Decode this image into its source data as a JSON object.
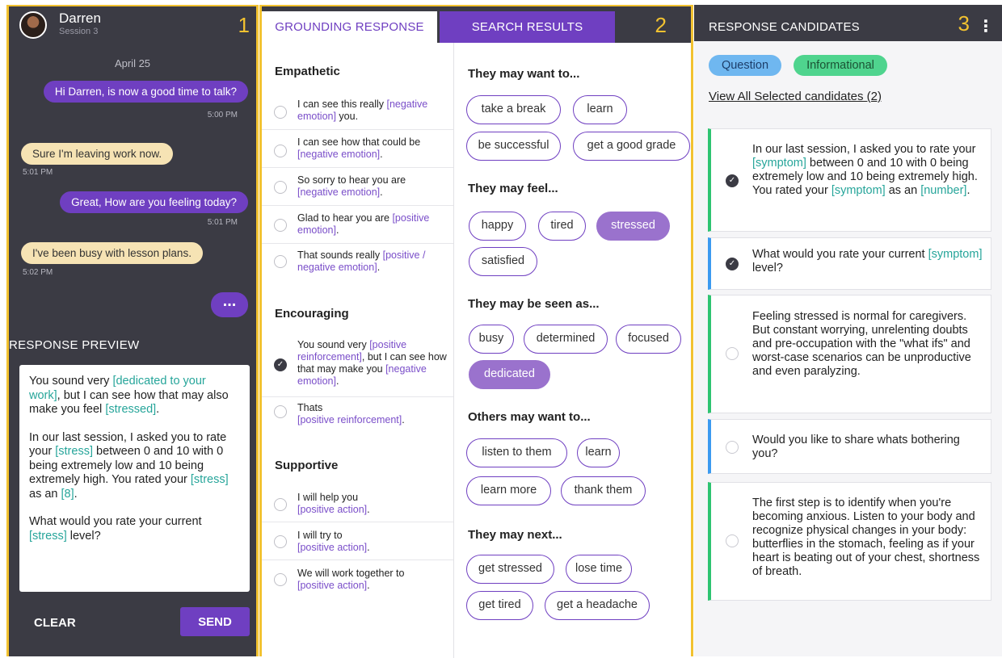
{
  "panel1": {
    "number": "1",
    "user_name": "Darren",
    "session": "Session 3",
    "date": "April 25",
    "messages": [
      {
        "text": "Hi Darren, is now a good time to talk?",
        "time": "5:00 PM"
      },
      {
        "text": "Sure I'm leaving work now.",
        "time": "5:01 PM"
      },
      {
        "text": "Great, How are you feeling today?",
        "time": "5:01 PM"
      },
      {
        "text": "I've been busy with lesson plans.",
        "time": "5:02 PM"
      }
    ],
    "more_label": "...",
    "preview_title": "RESPONSE PREVIEW",
    "preview": {
      "p1_a": "You sound very ",
      "p1_ph1": "[dedicated to your work]",
      "p1_b": ", but I can see how that may also make you feel ",
      "p1_ph2": "[stressed]",
      "p1_c": ".",
      "p2_a": "In our last session, I asked you to rate your ",
      "p2_ph1": "[stress]",
      "p2_b": " between 0 and 10 with 0 being extremely low and 10 being extremely high. You rated your ",
      "p2_ph2": "[stress]",
      "p2_c": " as an ",
      "p2_ph3": "[8]",
      "p2_d": ".",
      "p3_a": "What would you rate your current ",
      "p3_ph1": "[stress]",
      "p3_b": " level?"
    },
    "clear_label": "CLEAR",
    "send_label": "SEND"
  },
  "panel2": {
    "number": "2",
    "tabs": [
      "GROUNDING RESPONSE",
      "SEARCH RESULTS"
    ],
    "categories": {
      "empathetic": {
        "title": "Empathetic",
        "options": [
          {
            "a": "I can see this really ",
            "ph": "[negative emotion]",
            "b": " you."
          },
          {
            "a": "I can see how that could be ",
            "ph": "[negative emotion]",
            "b": "."
          },
          {
            "a": "So sorry to hear you are ",
            "ph": "[negative emotion]",
            "b": "."
          },
          {
            "a": "Glad to hear you are ",
            "ph": "[positive emotion]",
            "b": "."
          },
          {
            "a": "That sounds really ",
            "ph": "[positive / negative emotion]",
            "b": "."
          }
        ]
      },
      "encouraging": {
        "title": "Encouraging",
        "options": [
          {
            "a": "You sound very ",
            "ph": "[positive reinforcement]",
            "b": ", but I can see how that may make you ",
            "ph2": "[negative emotion]",
            "c": "."
          },
          {
            "a": "Thats ",
            "ph": "[positive reinforcement]",
            "b": "."
          }
        ]
      },
      "supportive": {
        "title": "Supportive",
        "options": [
          {
            "a": "I will help you ",
            "ph": "[positive action]",
            "b": "."
          },
          {
            "a": "I will try to ",
            "ph": "[positive action]",
            "b": "."
          },
          {
            "a": "We will work together to ",
            "ph": "[positive action]",
            "b": "."
          }
        ]
      }
    },
    "sections": [
      {
        "title": "They may want to...",
        "chips": [
          "take a break",
          "learn",
          "be successful",
          "get a good grade"
        ]
      },
      {
        "title": "They may feel...",
        "chips": [
          "happy",
          "tired",
          "stressed",
          "satisfied"
        ]
      },
      {
        "title": "They may be seen as...",
        "chips": [
          "busy",
          "determined",
          "focused",
          "dedicated"
        ]
      },
      {
        "title": "Others may want to...",
        "chips": [
          "listen to them",
          "learn",
          "learn more",
          "thank them"
        ]
      },
      {
        "title": "They may next...",
        "chips": [
          "get stressed",
          "lose time",
          "get tired",
          "get a headache"
        ]
      }
    ]
  },
  "panel3": {
    "number": "3",
    "title": "RESPONSE CANDIDATES",
    "tags": [
      "Question",
      "Informational"
    ],
    "view_all": "View All Selected candidates (2)",
    "cards": [
      {
        "a": "In our last session, I asked you to rate your ",
        "ph1": "[symptom]",
        "b": " between 0 and 10 with 0 being extremely low and 10 being extremely high. You rated your ",
        "ph2": "[symptom]",
        "c": " as an ",
        "ph3": "[number]",
        "d": "."
      },
      {
        "a": "What would you rate your current ",
        "ph1": "[symptom]",
        "b": " level?"
      },
      {
        "a": "Feeling stressed is normal for caregivers. But constant worrying, unrelenting doubts and pre-occupation with the \"what ifs\" and worst-case scenarios can be unproductive and even paralyzing."
      },
      {
        "a": "Would you like to share whats bothering you?"
      },
      {
        "a": "The first step is to identify when you're becoming anxious. Listen to your body and recognize physical changes in your body: butterflies in the stomach, feeling as if your heart is beating out of your chest, shortness of breath."
      }
    ]
  },
  "colors": {
    "accent_purple": "#6f3fc1",
    "panel_outline": "#f2c230",
    "dark_bg": "#3b3b44",
    "placeholder_teal": "#26a59a",
    "card_green": "#2ec471",
    "card_blue": "#3b9af0"
  },
  "icons": [
    "avatar",
    "more-dots-icon",
    "check-icon",
    "kebab-menu-icon"
  ]
}
